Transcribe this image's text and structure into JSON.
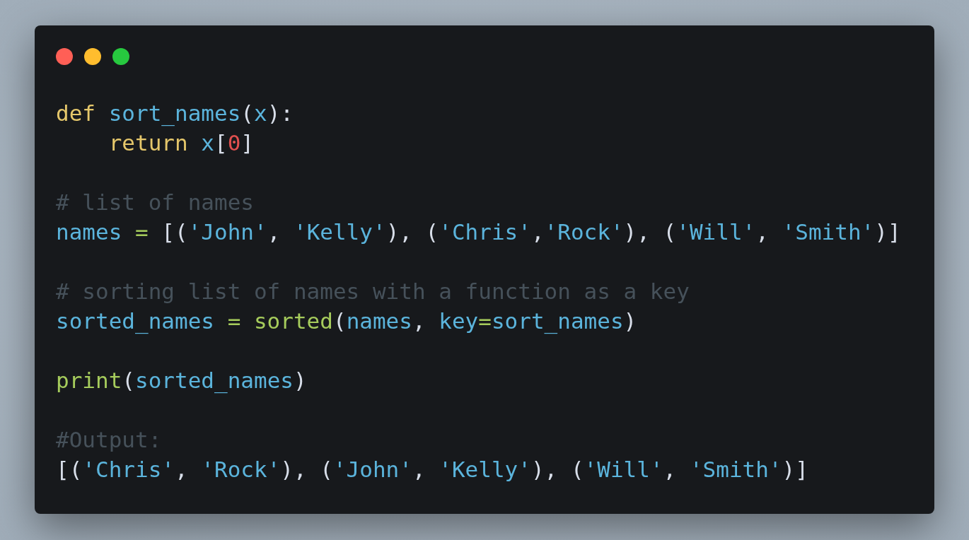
{
  "window": {
    "controls": [
      {
        "kind": "close"
      },
      {
        "kind": "minimize"
      },
      {
        "kind": "maximize"
      }
    ]
  },
  "code_blocks": [
    [
      [
        {
          "kind": "keyword",
          "text": "def"
        },
        {
          "kind": "name",
          "text": " sort_names"
        },
        {
          "kind": "punct",
          "text": "("
        },
        {
          "kind": "name",
          "text": "x"
        },
        {
          "kind": "punct",
          "text": "):"
        }
      ],
      [
        {
          "kind": "keyword",
          "text": "    return"
        },
        {
          "kind": "name",
          "text": " x"
        },
        {
          "kind": "punct",
          "text": "["
        },
        {
          "kind": "number",
          "text": "0"
        },
        {
          "kind": "punct",
          "text": "]"
        }
      ]
    ],
    [
      [
        {
          "kind": "comment",
          "text": "# list of names"
        }
      ],
      [
        {
          "kind": "name",
          "text": "names"
        },
        {
          "kind": "operator",
          "text": " ="
        },
        {
          "kind": "punct",
          "text": " [("
        },
        {
          "kind": "string",
          "text": "'John'"
        },
        {
          "kind": "punct",
          "text": ", "
        },
        {
          "kind": "string",
          "text": "'Kelly'"
        },
        {
          "kind": "punct",
          "text": "), ("
        },
        {
          "kind": "string",
          "text": "'Chris'"
        },
        {
          "kind": "punct",
          "text": ","
        },
        {
          "kind": "string",
          "text": "'Rock'"
        },
        {
          "kind": "punct",
          "text": "), ("
        },
        {
          "kind": "string",
          "text": "'Will'"
        },
        {
          "kind": "punct",
          "text": ", "
        },
        {
          "kind": "string",
          "text": "'Smith'"
        },
        {
          "kind": "punct",
          "text": ")]"
        }
      ]
    ],
    [
      [
        {
          "kind": "comment",
          "text": "# sorting list of names with a function as a key"
        }
      ],
      [
        {
          "kind": "name",
          "text": "sorted_names"
        },
        {
          "kind": "operator",
          "text": " ="
        },
        {
          "kind": "builtin",
          "text": " sorted"
        },
        {
          "kind": "punct",
          "text": "("
        },
        {
          "kind": "name",
          "text": "names"
        },
        {
          "kind": "punct",
          "text": ", "
        },
        {
          "kind": "name",
          "text": "key"
        },
        {
          "kind": "operator",
          "text": "="
        },
        {
          "kind": "name",
          "text": "sort_names"
        },
        {
          "kind": "punct",
          "text": ")"
        }
      ]
    ],
    [
      [
        {
          "kind": "builtin",
          "text": "print"
        },
        {
          "kind": "punct",
          "text": "("
        },
        {
          "kind": "name",
          "text": "sorted_names"
        },
        {
          "kind": "punct",
          "text": ")"
        }
      ]
    ],
    [
      [
        {
          "kind": "comment",
          "text": "#Output:"
        }
      ],
      [
        {
          "kind": "punct",
          "text": "[("
        },
        {
          "kind": "string",
          "text": "'Chris'"
        },
        {
          "kind": "punct",
          "text": ", "
        },
        {
          "kind": "string",
          "text": "'Rock'"
        },
        {
          "kind": "punct",
          "text": "), ("
        },
        {
          "kind": "string",
          "text": "'John'"
        },
        {
          "kind": "punct",
          "text": ", "
        },
        {
          "kind": "string",
          "text": "'Kelly'"
        },
        {
          "kind": "punct",
          "text": "), ("
        },
        {
          "kind": "string",
          "text": "'Will'"
        },
        {
          "kind": "punct",
          "text": ", "
        },
        {
          "kind": "string",
          "text": "'Smith'"
        },
        {
          "kind": "punct",
          "text": ")]"
        }
      ]
    ]
  ]
}
